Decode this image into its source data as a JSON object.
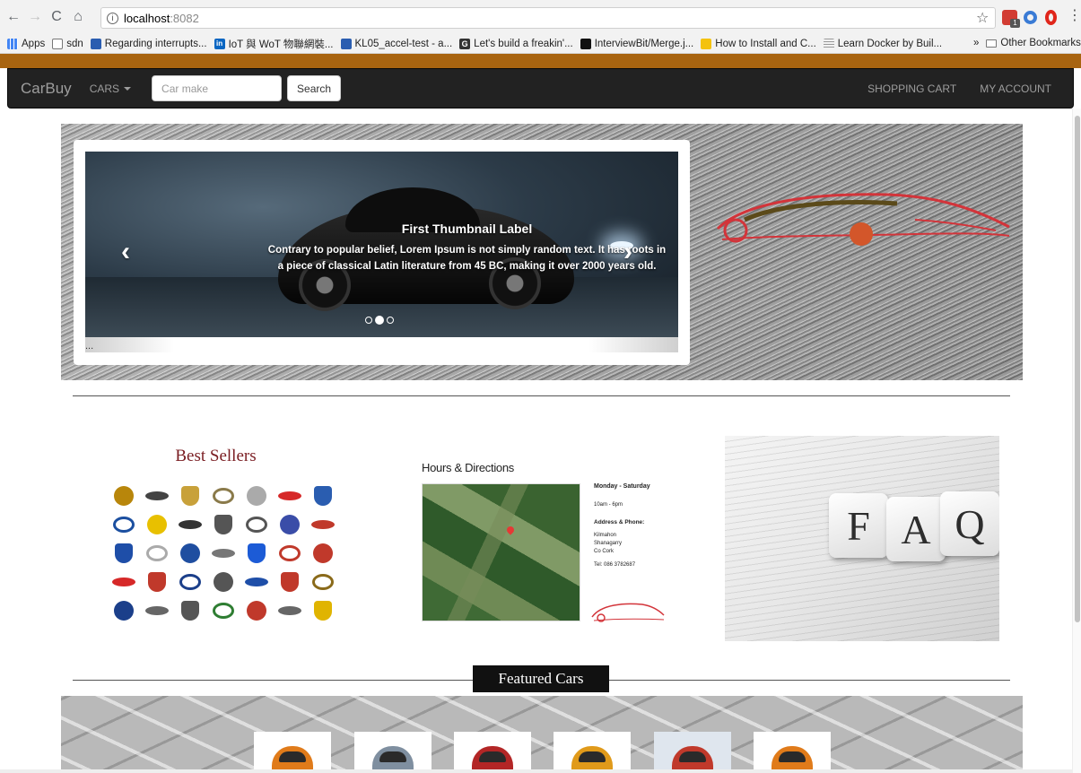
{
  "browser": {
    "url_host": "localhost",
    "url_port": ":8082",
    "bookmarks": [
      {
        "label": "Apps",
        "icon": "apps-grid-icon"
      },
      {
        "label": "sdn",
        "icon": "folder-icon"
      },
      {
        "label": "Regarding interrupts...",
        "icon": "page-icon"
      },
      {
        "label": "IoT 與 WoT 物聯網裝...",
        "icon": "linkedin-icon"
      },
      {
        "label": "KL05_accel-test - a...",
        "icon": "page-icon"
      },
      {
        "label": "Let's build a freakin'...",
        "icon": "g-icon"
      },
      {
        "label": "InterviewBit/Merge.j...",
        "icon": "github-icon"
      },
      {
        "label": "How to Install and C...",
        "icon": "bulb-icon"
      },
      {
        "label": "Learn Docker by Buil...",
        "icon": "lines-icon"
      }
    ],
    "more_bookmarks": "»",
    "other_bookmarks": "Other Bookmarks",
    "ext_badge": "1"
  },
  "navbar": {
    "brand": "CarBuy",
    "cars_label": "CARS",
    "search_placeholder": "Car make",
    "search_button": "Search",
    "cart_label": "SHOPPING CART",
    "account_label": "MY ACCOUNT"
  },
  "carousel": {
    "title": "First Thumbnail Label",
    "text": "Contrary to popular belief, Lorem Ipsum is not simply random text. It has roots in a piece of classical Latin literature from 45 BC, making it over 2000 years old.",
    "prev": "‹",
    "next": "›",
    "slide_count": 3,
    "active_index": 1,
    "ellipsis": "..."
  },
  "best_sellers": {
    "title": "Best Sellers",
    "logos": [
      "#b8860b",
      "#444",
      "#c8a13a",
      "#8a7a4a",
      "#aaa",
      "#d62828",
      "#2a5db0",
      "#1b4fa0",
      "#e8c000",
      "#333",
      "#555",
      "#555",
      "#3a4da8",
      "#c0392b",
      "#1e4ea8",
      "#aaa",
      "#1f4ea0",
      "#777",
      "#1c5bd6",
      "#c0392b",
      "#c0392b",
      "#d62828",
      "#c0392b",
      "#1b3f8a",
      "#555",
      "#1e4ea8",
      "#c0392b",
      "#8a6a1a",
      "#1b3f8a",
      "#666",
      "#555",
      "#2e7d32",
      "#c0392b",
      "#666",
      "#e0b400"
    ]
  },
  "hours": {
    "title": "Hours & Directions",
    "days": "Monday - Saturday",
    "times": "10am - 6pm",
    "address_heading": "Address & Phone:",
    "address_lines": [
      "Kilmahon",
      "Shanagarry",
      "Co Cork"
    ],
    "phone": "Tel: 086 3782687"
  },
  "faq": {
    "letters": [
      "F",
      "A",
      "Q"
    ]
  },
  "featured": {
    "title": "Featured Cars",
    "cars": [
      {
        "color": "#e07b1a"
      },
      {
        "color": "#7f8fa0"
      },
      {
        "color": "#b32626"
      },
      {
        "color": "#e09a1a"
      },
      {
        "color": "#c0392b"
      },
      {
        "color": "#e07b1a"
      }
    ]
  },
  "colors": {
    "brown_band": "#a86410",
    "navbar_bg": "#222222",
    "best_sellers_title": "#7a1d22"
  }
}
